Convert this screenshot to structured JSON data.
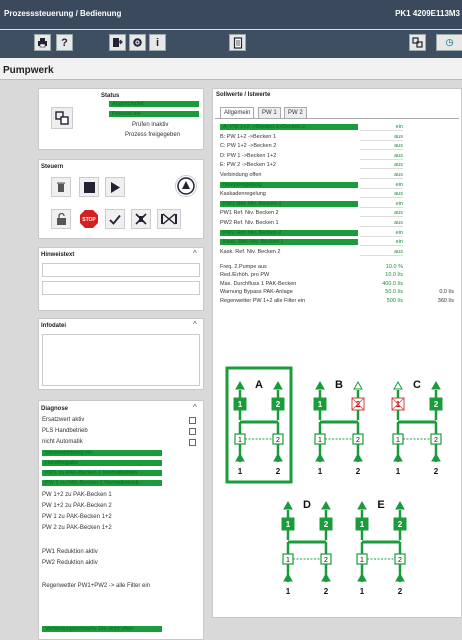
{
  "window": {
    "title": "Prozesssteuerung / Bedienung",
    "right_title": "PK1 4209E113M3"
  },
  "toolbar": {
    "icons": [
      "printer-icon",
      "help-icon",
      "export-icon",
      "settings-icon",
      "info-icon",
      "document-icon",
      "plant-icon"
    ],
    "help": "?",
    "info": "i"
  },
  "page": {
    "title": "Pumpwerk"
  },
  "status": {
    "heading": "Status",
    "bars": [
      "Angeschaltet",
      "Prozess ein"
    ],
    "lines": [
      "Prüfen inaktiv",
      "Prozess freigegeben"
    ]
  },
  "steuern": {
    "heading": "Steuern"
  },
  "hinweis": {
    "heading": "Hinweistext"
  },
  "infodatei": {
    "heading": "Infodatei"
  },
  "diagnose": {
    "heading": "Diagnose",
    "checks": [
      "Ersatzwert aktiv",
      "PLS Handbetrieb",
      "nicht Automatik"
    ],
    "bars": [
      "Sammelstörung ein",
      "Handfreigabe",
      "PW1 zu PAK-Becken 1 Normalbetrieb",
      "PW 2 zu PAK-Becken 2 Normalbetrieb"
    ],
    "lines": [
      "PW 1+2 zu PAK-Becken 1",
      "PW 1+2 zu PAK-Becken 2",
      "PW 1 zu PAK-Becken 1+2",
      "PW 2 zu PAK-Becken 1+2"
    ],
    "lines2": [
      "PW1 Reduktion aktiv",
      "PW2 Reduktion aktiv"
    ],
    "line3": "Regenwetter PW1+PW2 -> alle Filter ein",
    "footer": "Verbindungsschwelle Die nicht offen"
  },
  "soll": {
    "heading": "Sollwerte / Istwerte",
    "tabs": [
      "Allgemein",
      "PW 1",
      "PW 2"
    ],
    "rows": [
      {
        "label": "A: PW 1+2 ->Becken 1+Becken 2",
        "value": "ein",
        "bar": true
      },
      {
        "label": "B: PW 1+2 ->Becken 1",
        "value": "aus",
        "bar": false
      },
      {
        "label": "C: PW 1+2 ->Becken 2",
        "value": "aus",
        "bar": false
      },
      {
        "label": "D: PW 1 ->Becken 1+2",
        "value": "aus",
        "bar": false
      },
      {
        "label": "E: PW 2 ->Becken 1+2",
        "value": "aus",
        "bar": false
      },
      {
        "label": "Verbindung offen",
        "value": "aus",
        "bar": false
      },
      {
        "label": "Niveauregelung",
        "value": "ein",
        "bar": true
      },
      {
        "label": "Kaskadenregelung",
        "value": "aus",
        "bar": false
      },
      {
        "label": "PW1 Ref. Niv. Becken 1",
        "value": "ein",
        "bar": true
      },
      {
        "label": "PW1 Ref. Niv. Becken 2",
        "value": "aus",
        "bar": false
      },
      {
        "label": "PW2 Ref. Niv. Becken 1",
        "value": "aus",
        "bar": false
      },
      {
        "label": "PW2 Ref. Niv. Becken 2",
        "value": "ein",
        "bar": true
      },
      {
        "label": "Kask. Ref. Niv. Becken 1",
        "value": "ein",
        "bar": true
      },
      {
        "label": "Kask. Ref. Niv. Becken 2",
        "value": "aus",
        "bar": false
      }
    ],
    "params": [
      {
        "label": "Freq. 2.Pumpe aus",
        "value": "10.0 %",
        "extra": ""
      },
      {
        "label": "Red./Erhöh. pro PW",
        "value": "10.0 l/s",
        "extra": ""
      },
      {
        "label": "Max. Durchfluss 1 PAK-Becken",
        "value": "400.0 l/s",
        "extra": ""
      },
      {
        "label": "Warnung Bypass PAK-Anlage",
        "value": "50.0 l/s",
        "extra": "0.0 l/s"
      },
      {
        "label": "Regenwetter PW 1+2 alle Filter ein",
        "value": "500 l/s",
        "extra": "360 l/s"
      }
    ]
  },
  "diagram": {
    "modes": [
      "A",
      "B",
      "C",
      "D",
      "E"
    ],
    "pumps": [
      "1",
      "2"
    ],
    "bottom": [
      "1",
      "2"
    ]
  },
  "colors": {
    "green": "#1a9c3a",
    "header": "#3a4a5c"
  }
}
